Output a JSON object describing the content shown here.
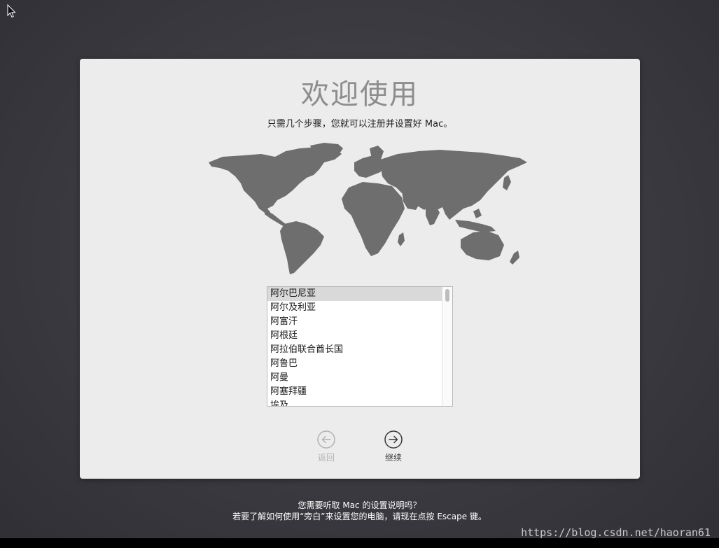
{
  "panel": {
    "title": "欢迎使用",
    "subtitle": "只需几个步骤，您就可以注册并设置好 Mac。"
  },
  "country_list": {
    "items": [
      "阿尔巴尼亚",
      "阿尔及利亚",
      "阿富汗",
      "阿根廷",
      "阿拉伯联合酋长国",
      "阿鲁巴",
      "阿曼",
      "阿塞拜疆",
      "埃及"
    ],
    "selected_index": 0
  },
  "nav": {
    "back_label": "返回",
    "continue_label": "继续"
  },
  "voiceover": {
    "line1": "您需要听取 Mac 的设置说明吗？",
    "line2": "若要了解如何使用“旁白”来设置您的电脑，请现在点按 Escape 键。"
  },
  "watermark": "https://blog.csdn.net/haoran61",
  "colors": {
    "panel_bg": "#ececec",
    "map_fill": "#6e6e6e",
    "desktop_bg": "#3c3c42"
  },
  "icons": {
    "cursor": "arrow-cursor-icon",
    "back": "arrow-left-circle-icon",
    "continue": "arrow-right-circle-icon"
  }
}
